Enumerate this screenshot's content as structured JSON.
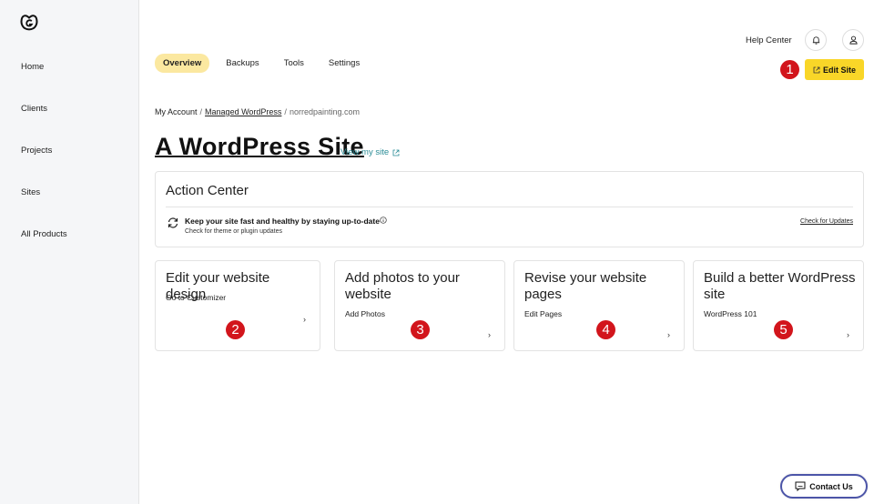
{
  "sidebar": {
    "logo": "godaddy-logo",
    "items": [
      {
        "label": "Home"
      },
      {
        "label": "Clients"
      },
      {
        "label": "Projects"
      },
      {
        "label": "Sites"
      },
      {
        "label": "All Products"
      }
    ]
  },
  "header": {
    "tabs": [
      {
        "label": "Overview",
        "active": true
      },
      {
        "label": "Backups",
        "active": false
      },
      {
        "label": "Tools",
        "active": false
      },
      {
        "label": "Settings",
        "active": false
      }
    ],
    "help_center": "Help Center",
    "edit_site": "Edit Site"
  },
  "breadcrumb": {
    "items": [
      "My Account",
      "Managed WordPress",
      "norredpainting.com"
    ],
    "separator": "/"
  },
  "page": {
    "title": "A WordPress Site",
    "view_site": "View my site"
  },
  "action_center": {
    "title": "Action Center",
    "message": "Keep your site fast and healthy by staying up-to-date",
    "sub": "Check for theme or plugin updates",
    "link": "Check for Updates"
  },
  "tasks": [
    {
      "title": "Edit your website design",
      "sub": "Go to Customizer",
      "badge": "2"
    },
    {
      "title": "Add photos to your website",
      "sub": "Add Photos",
      "badge": "3"
    },
    {
      "title": "Revise your website pages",
      "sub": "Edit Pages",
      "badge": "4"
    },
    {
      "title": "Build a better WordPress site",
      "sub": "WordPress 101",
      "badge": "5"
    }
  ],
  "annotations": {
    "edit_site_badge": "1"
  },
  "contact": {
    "label": "Contact Us"
  },
  "colors": {
    "accent_yellow": "#f9d628",
    "tab_active": "#fbe8a0",
    "badge_red": "#d2151c",
    "link_teal": "#2a8c96"
  }
}
